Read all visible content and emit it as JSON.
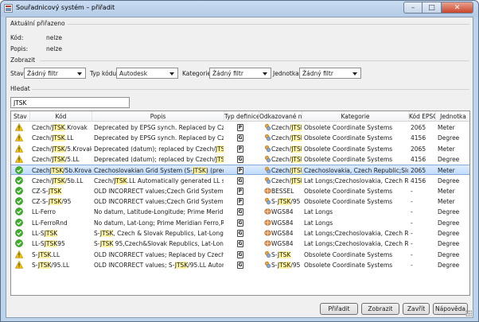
{
  "window": {
    "title": "Souřadnicový systém – přiřadit"
  },
  "current": {
    "section": "Aktuální přiřazeno",
    "kod_label": "Kód:",
    "kod_value": "nelze",
    "popis_label": "Popis:",
    "popis_value": "nelze"
  },
  "filters": {
    "section": "Zobrazit",
    "stav_label": "Stav:",
    "stav_value": "Žádný filtr",
    "typ_label": "Typ kódu:",
    "typ_value": "Autodesk",
    "kategorie_label": "Kategorie:",
    "kategorie_value": "Žádný filtr",
    "jednotka_label": "Jednotka:",
    "jednotka_value": "Žádný filtr"
  },
  "search": {
    "section": "Hledat",
    "value": "JTSK"
  },
  "grid": {
    "columns": [
      "Stav",
      "Kód",
      "Popis",
      "Typ definice",
      "Odkazované na",
      "Kategorie",
      "Kód EPSG",
      "Jednotka"
    ],
    "rows": [
      {
        "status": "warning",
        "kod": [
          "Czech/",
          "JTSK",
          ".Krovak"
        ],
        "popis": [
          "Deprecated by EPSG synch. Replaced by Czech",
          ""
        ],
        "typ": "P",
        "ref": [
          "Czech/",
          "JTSK",
          ""
        ],
        "ref_icon": "datum-icon",
        "kat": "Obsolete Coordinate Systems",
        "epsg": "2065",
        "jed": "Meter"
      },
      {
        "status": "warning",
        "kod": [
          "Czech/",
          "JTSK",
          ".LL"
        ],
        "popis": [
          "Deprecated by EPSG synch. Replaced by Czech",
          ""
        ],
        "typ": "G",
        "ref": [
          "Czech/",
          "JTSK",
          ""
        ],
        "ref_icon": "datum-icon",
        "kat": "Obsolete Coordinate Systems",
        "epsg": "4156",
        "jed": "Degree"
      },
      {
        "status": "warning",
        "kod": [
          "Czech/",
          "JTSK",
          "/5.Krovak"
        ],
        "popis": [
          "Deprecated (datum); replaced by Czech/",
          "JTSK",
          "/5..."
        ],
        "typ": "P",
        "ref": [
          "Czech/",
          "JTSK",
          "/5"
        ],
        "ref_icon": "datum-icon",
        "kat": "Obsolete Coordinate Systems",
        "epsg": "2065",
        "jed": "Meter"
      },
      {
        "status": "warning",
        "kod": [
          "Czech/",
          "JTSK",
          "/5.LL"
        ],
        "popis": [
          "Deprecated (datum); replaced by Czech/",
          "JTSK",
          "/5..."
        ],
        "typ": "G",
        "ref": [
          "Czech/",
          "JTSK",
          "/5"
        ],
        "ref_icon": "datum-icon",
        "kat": "Obsolete Coordinate Systems",
        "epsg": "4156",
        "jed": "Degree"
      },
      {
        "status": "ok",
        "selected": true,
        "kod": [
          "Czech",
          "JTSK",
          "/5b.Krovak"
        ],
        "popis": [
          "Czechoslovakian Grid System (S-",
          "JTSK",
          ") (precise..."
        ],
        "typ": "P",
        "ref": [
          "Czech/",
          "JTSK",
          "/5b"
        ],
        "ref_icon": "datum-icon",
        "kat": "Czechoslovakia, Czech Republic;Slovak...",
        "epsg": "2065",
        "jed": "Meter"
      },
      {
        "status": "ok",
        "kod": [
          "Czech/",
          "JTSK",
          "/5b.LL"
        ],
        "popis": [
          "Czech/",
          "JTSK",
          ".LL Automatically generated LL syst..."
        ],
        "typ": "G",
        "ref": [
          "Czech/",
          "JTSK",
          "/5b"
        ],
        "ref_icon": "datum-icon",
        "kat": "Lat Longs;Czechoslovakia, Czech Repu...",
        "epsg": "4156",
        "jed": "Degree"
      },
      {
        "status": "ok",
        "kod": [
          "CZ-S-",
          "JTSK",
          ""
        ],
        "popis": [
          "OLD INCORRECT values;Czech Grid System (S-J...",
          ""
        ],
        "typ": "P",
        "ref": [
          "BESSEL",
          "",
          ""
        ],
        "ref_icon": "ellipsoid-icon",
        "kat": "Obsolete Coordinate Systems",
        "epsg": "-",
        "jed": "Meter"
      },
      {
        "status": "ok",
        "kod": [
          "CZ-S-",
          "JTSK",
          "/95"
        ],
        "popis": [
          "OLD INCORRECT values;Czech Grid System (S-",
          "JTSK",
          "..."
        ],
        "typ": "P",
        "ref": [
          "S-",
          "JTSK",
          "/95"
        ],
        "ref_icon": "datum-icon",
        "kat": "Obsolete Coordinate Systems",
        "epsg": "-",
        "jed": "Meter"
      },
      {
        "status": "ok",
        "kod": [
          "LL-Ferro",
          "",
          ""
        ],
        "popis": [
          "No datum, Latitude-Longitude; Prime Meridian ...",
          ""
        ],
        "typ": "G",
        "ref": [
          "WGS84",
          "",
          ""
        ],
        "ref_icon": "ellipsoid-icon",
        "kat": "Lat Longs",
        "epsg": "-",
        "jed": "Degree"
      },
      {
        "status": "ok",
        "kod": [
          "LL-FerroRnd",
          "",
          ""
        ],
        "popis": [
          "No datum, Lat-Long; Prime Meridian Ferro,Rou...",
          ""
        ],
        "typ": "G",
        "ref": [
          "WGS84",
          "",
          ""
        ],
        "ref_icon": "ellipsoid-icon",
        "kat": "Lat Longs",
        "epsg": "-",
        "jed": "Degree"
      },
      {
        "status": "ok",
        "kod": [
          "LL-S",
          "JTSK",
          ""
        ],
        "popis": [
          "S-",
          "JTSK",
          ", Czech & Slovak Republics, Lat-Long;PM..."
        ],
        "typ": "G",
        "ref": [
          "WGS84",
          "",
          ""
        ],
        "ref_icon": "ellipsoid-icon",
        "kat": "Lat Longs;Czechoslovakia, Czech Repub...",
        "epsg": "-",
        "jed": "Degree"
      },
      {
        "status": "ok",
        "kod": [
          "LL-S",
          "JTSK",
          "95"
        ],
        "popis": [
          "S-",
          "JTSK",
          " 95,Czech&Slovak Republics, Lat-Long;P..."
        ],
        "typ": "G",
        "ref": [
          "WGS84",
          "",
          ""
        ],
        "ref_icon": "ellipsoid-icon",
        "kat": "Lat Longs;Czechoslovakia, Czech Repub...",
        "epsg": "-",
        "jed": "Degree"
      },
      {
        "status": "warning",
        "kod": [
          "S-",
          "JTSK",
          ".LL"
        ],
        "popis": [
          "OLD INCORRECT values; Replaced by Czech/",
          "JT",
          ""
        ],
        "typ": "G",
        "ref": [
          "S-",
          "JTSK",
          ""
        ],
        "ref_icon": "datum-icon",
        "kat": "Obsolete Coordinate Systems",
        "epsg": "-",
        "jed": "Degree"
      },
      {
        "status": "warning",
        "kod": [
          "S-",
          "JTSK",
          "/95.LL"
        ],
        "popis": [
          "OLD INCORRECT values; S-",
          "JTSK",
          "/95.LL Automati..."
        ],
        "typ": "G",
        "ref": [
          "S-",
          "JTSK",
          "/95"
        ],
        "ref_icon": "datum-icon",
        "kat": "Obsolete Coordinate Systems",
        "epsg": "-",
        "jed": "Degree"
      }
    ]
  },
  "buttons": {
    "assign": "Přiřadit",
    "show": "Zobrazit",
    "close": "Zavřít",
    "help": "Nápověda"
  },
  "colors": {
    "selection": "#c1dcfc",
    "highlight": "#fdf3a4",
    "warning": "#f5c400",
    "ok": "#3fae2a"
  }
}
